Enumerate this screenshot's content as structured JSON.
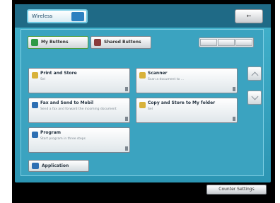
{
  "window": {
    "title": "Wireless",
    "close_label": "←"
  },
  "modes": [
    {
      "label": "My Buttons"
    },
    {
      "label": "Shared Buttons"
    }
  ],
  "tiles": [
    {
      "title": "Print and Store",
      "sub": "Sel",
      "icon": "folder-icon"
    },
    {
      "title": "Scanner",
      "sub": "Scan a document to ...",
      "icon": "folder-icon"
    },
    {
      "title": "Fax and Send to Mobil",
      "sub": "Send a fax and forward the incoming document",
      "icon": "fax-icon"
    },
    {
      "title": "Copy and Store to My folder",
      "sub": "Sel",
      "icon": "folder-icon"
    },
    {
      "title": "Program",
      "sub": "Start program in three steps",
      "icon": "program-icon"
    }
  ],
  "app_button": {
    "label": "Application"
  },
  "bottom_button": {
    "label": "Counter Settings"
  },
  "colors": {
    "screen": "#3aa4bf",
    "top_bar": "#1f6a86",
    "frame": "#000000"
  }
}
